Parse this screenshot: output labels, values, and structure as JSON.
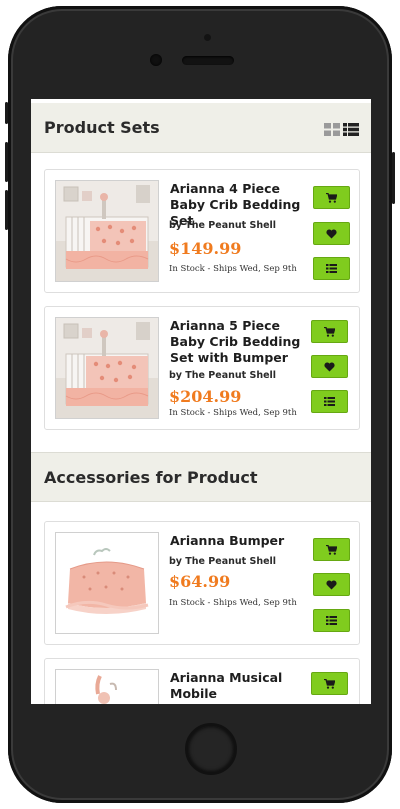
{
  "sections": [
    {
      "title": "Product Sets"
    },
    {
      "title": "Accessories for Product"
    }
  ],
  "view_toggle": {
    "grid_icon": "grid-view-icon",
    "list_icon": "list-view-icon",
    "active": "list"
  },
  "product_sets": [
    {
      "name": "Arianna 4 Piece Baby Crib Bedding Set",
      "brand": "by The Peanut Shell",
      "price": "$149.99",
      "stock": "In Stock - Ships Wed, Sep 9th"
    },
    {
      "name": "Arianna 5 Piece Baby Crib Bedding Set with Bumper",
      "brand": "by The Peanut Shell",
      "price": "$204.99",
      "stock": "In Stock - Ships Wed, Sep 9th"
    }
  ],
  "accessories": [
    {
      "name": "Arianna Bumper",
      "brand": "by The Peanut Shell",
      "price": "$64.99",
      "stock": "In Stock - Ships Wed, Sep 9th"
    },
    {
      "name": "Arianna Musical Mobile"
    }
  ],
  "colors": {
    "accent_green": "#80cc1e",
    "price_orange": "#f07b1f",
    "header_bg": "#efefe8"
  }
}
